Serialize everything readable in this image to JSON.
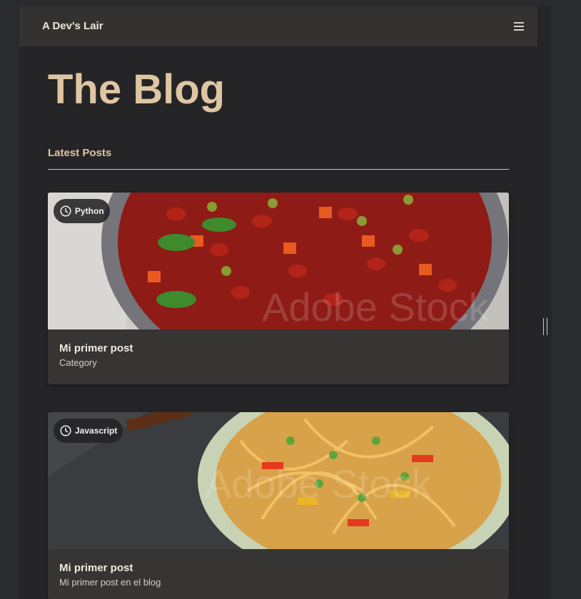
{
  "nav": {
    "brand": "A Dev's Lair",
    "menu_icon": "hamburger-menu-icon"
  },
  "page": {
    "title": "The Blog",
    "section_heading": "Latest Posts"
  },
  "posts": [
    {
      "tag": "Python",
      "title": "Mi primer post",
      "subtitle": "Category",
      "image": "bean-stew-photo"
    },
    {
      "tag": "Javascript",
      "title": "Mi primer post",
      "subtitle": "Mi primer post en el blog",
      "image": "noodles-bowl-photo"
    }
  ],
  "images": {
    "watermark": "Adobe Stock"
  },
  "colors": {
    "title": "#dfc6a3",
    "navbar": "#333231",
    "card": "#363534",
    "background": "#252527"
  }
}
